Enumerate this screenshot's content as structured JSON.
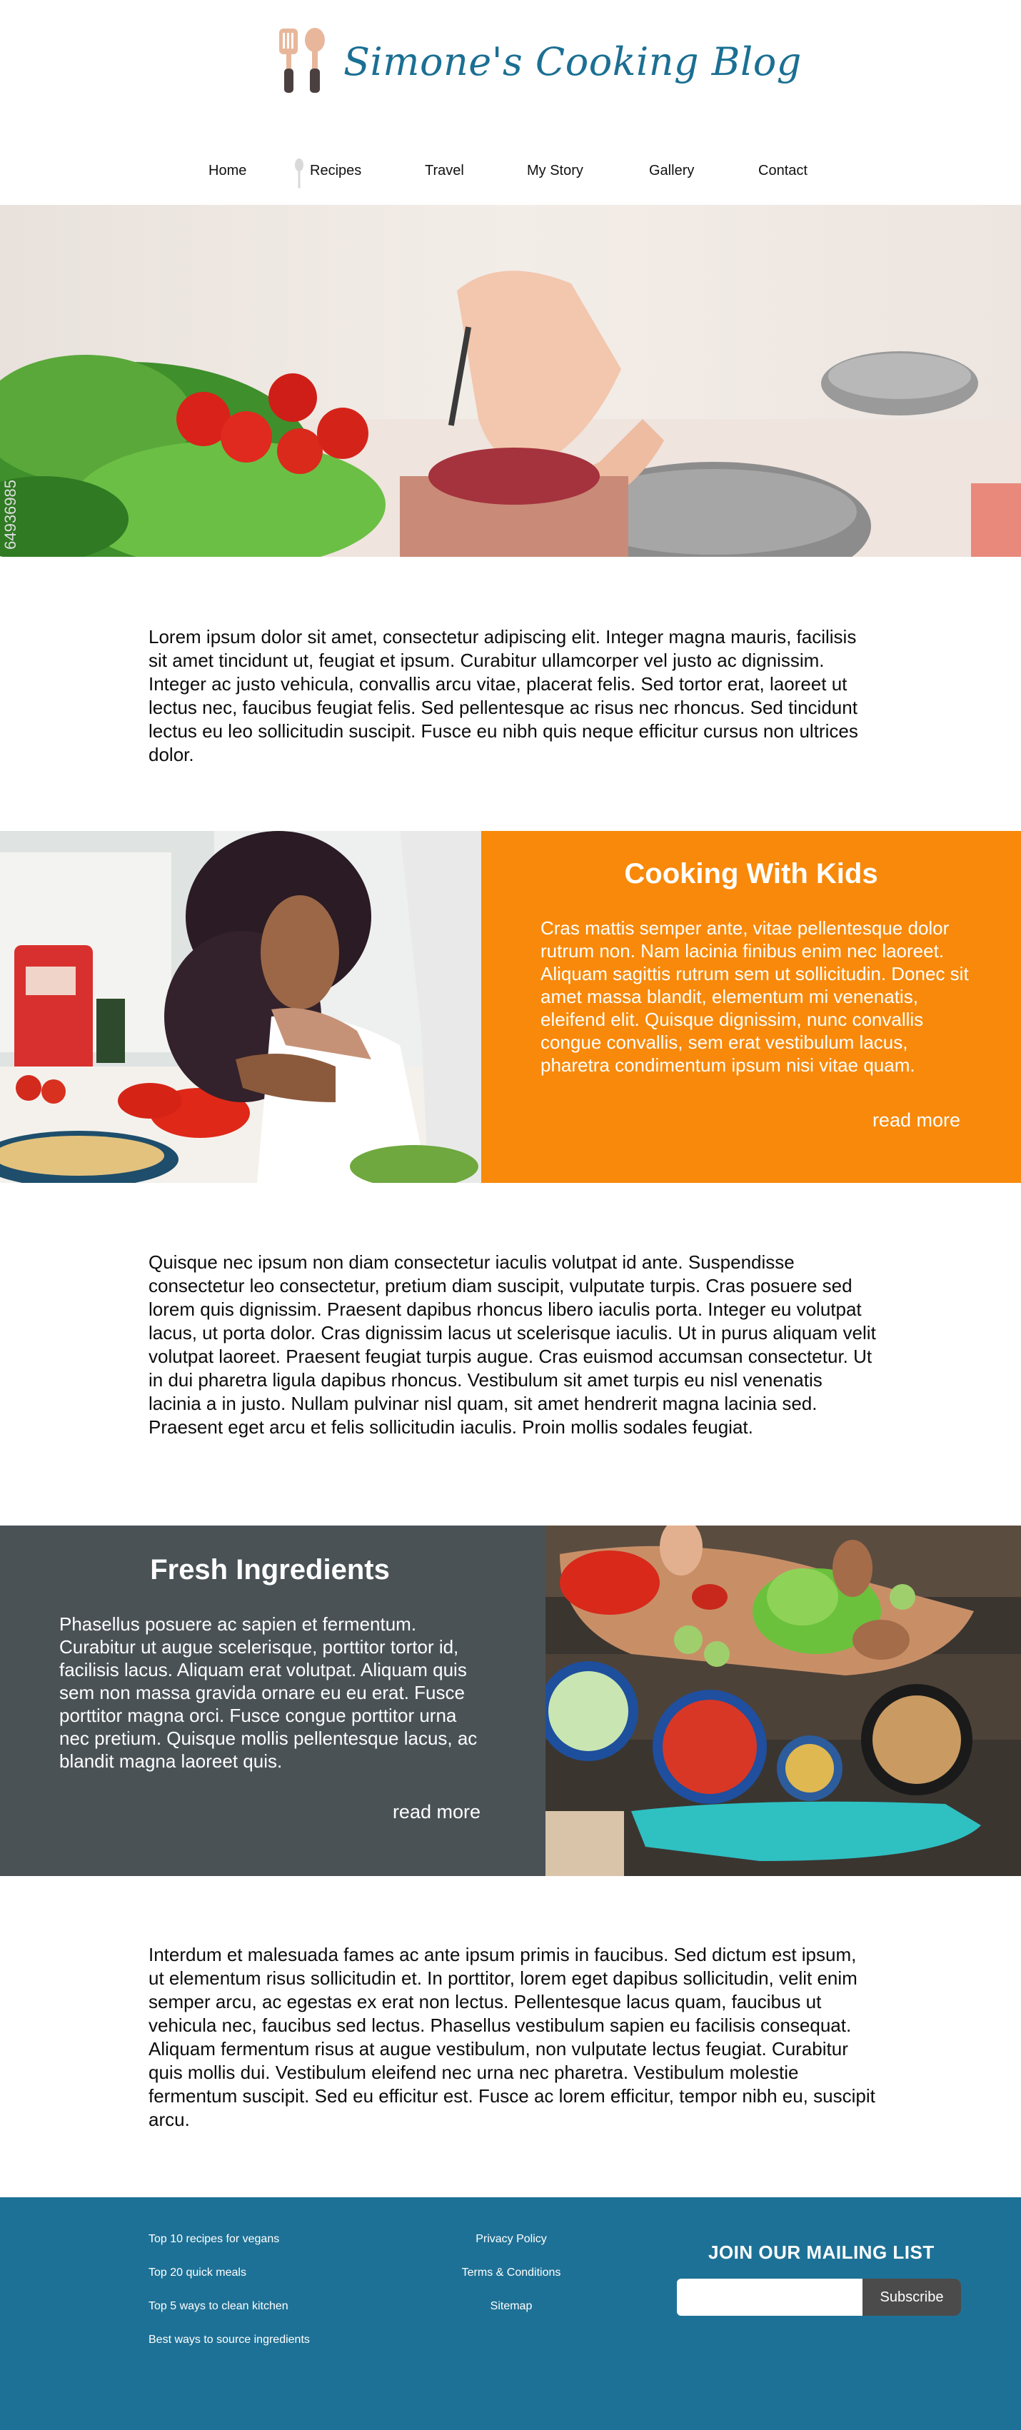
{
  "site": {
    "title": "Simone's Cooking Blog",
    "brand_color": "#1b6f93",
    "logo_icon": "kitchen-utensils-icon"
  },
  "nav": {
    "items": [
      {
        "label": "Home"
      },
      {
        "label": "Recipes"
      },
      {
        "label": "Travel"
      },
      {
        "label": "My Story"
      },
      {
        "label": "Gallery"
      },
      {
        "label": "Contact"
      }
    ],
    "active_marker_icon": "spoon-icon"
  },
  "hero": {
    "image": "vegetable-chopping-photo",
    "watermark": "64936985"
  },
  "intro": {
    "text": "Lorem ipsum dolor sit amet, consectetur adipiscing elit. Integer magna mauris, facilisis sit amet tincidunt ut, feugiat et ipsum. Curabitur ullamcorper vel justo ac dignissim. Integer ac justo vehicula, convallis arcu vitae, placerat felis. Sed tortor erat, laoreet ut lectus nec, faucibus feugiat felis. Sed pellentesque ac risus nec rhoncus. Sed tincidunt lectus eu leo sollicitudin suscipit. Fusce eu nibh quis neque efficitur cursus non ultrices dolor."
  },
  "feature_kids": {
    "title": "Cooking With Kids",
    "body": "Cras mattis semper ante, vitae pellentesque dolor rutrum non. Nam lacinia finibus enim nec laoreet. Aliquam sagittis rutrum sem ut sollicitudin. Donec sit amet massa blandit, elementum mi venenatis, eleifend elit. Quisque dignissim, nunc convallis congue convallis, sem erat vestibulum lacus, pharetra condimentum ipsum nisi vitae quam.",
    "read_more": "read more",
    "panel_color": "#f8890a"
  },
  "middle": {
    "text": "Quisque nec ipsum non diam consectetur iaculis volutpat id ante. Suspendisse consectetur leo consectetur, pretium diam suscipit, vulputate turpis. Cras posuere sed lorem quis dignissim. Praesent dapibus rhoncus libero iaculis porta. Integer eu volutpat lacus, ut porta dolor. Cras dignissim lacus ut scelerisque iaculis. Ut in purus aliquam velit volutpat laoreet. Praesent feugiat turpis augue. Cras euismod accumsan consectetur. Ut in dui pharetra ligula dapibus rhoncus. Vestibulum sit amet turpis eu nisl venenatis lacinia a in justo. Nullam pulvinar nisl quam, sit amet hendrerit magna lacinia sed. Praesent eget arcu et felis sollicitudin iaculis. Proin mollis sodales feugiat."
  },
  "feature_fresh": {
    "title": "Fresh Ingredients",
    "body": "Phasellus posuere ac sapien et fermentum. Curabitur ut augue scelerisque, porttitor tortor id, facilisis lacus. Aliquam erat volutpat. Aliquam quis sem non massa gravida ornare eu eu erat. Fusce porttitor magna orci. Fusce congue porttitor urna nec pretium. Quisque mollis pellentesque lacus, ac blandit magna laoreet quis.",
    "read_more": "read more",
    "panel_color": "#4a5256"
  },
  "closing": {
    "text": "Interdum et malesuada fames ac ante ipsum primis in faucibus. Sed dictum est ipsum, ut elementum risus sollicitudin et. In porttitor, lorem eget dapibus sollicitudin, velit enim semper arcu, ac egestas ex erat non lectus. Pellentesque lacus quam, faucibus ut vehicula nec, faucibus sed lectus. Phasellus vestibulum sapien eu facilisis consequat. Aliquam fermentum risus at augue vestibulum, non vulputate lectus feugiat. Curabitur quis mollis dui. Vestibulum eleifend nec urna nec pharetra. Vestibulum molestie fermentum suscipit. Sed eu efficitur est. Fusce ac lorem efficitur, tempor nibh eu, suscipit arcu."
  },
  "footer": {
    "bg_color": "#1e7196",
    "links_left": [
      "Top 10 recipes for vegans",
      "Top 20 quick meals",
      "Top 5 ways to clean kitchen",
      "Best ways to source ingredients"
    ],
    "links_center": [
      "Privacy Policy",
      "Terms & Conditions",
      "Sitemap"
    ],
    "mailing_title": "JOIN OUR MAILING LIST",
    "email_placeholder": "",
    "subscribe_label": "Subscribe"
  }
}
